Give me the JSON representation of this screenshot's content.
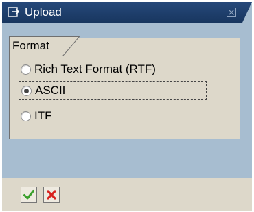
{
  "window": {
    "title": "Upload",
    "icon": "upload-icon"
  },
  "format_group": {
    "label": "Format",
    "options": [
      {
        "label": "Rich Text Format (RTF)",
        "selected": false
      },
      {
        "label": "ASCII",
        "selected": true
      },
      {
        "label": "ITF",
        "selected": false
      }
    ]
  },
  "toolbar": {
    "confirm_icon": "green-check-icon",
    "cancel_icon": "red-x-icon"
  },
  "colors": {
    "titlebar": "#1f3f6c",
    "dialog_background": "#a7bdd0",
    "panel_background": "#ddd8ca",
    "confirm": "#3aa02c",
    "cancel": "#d8211e"
  }
}
